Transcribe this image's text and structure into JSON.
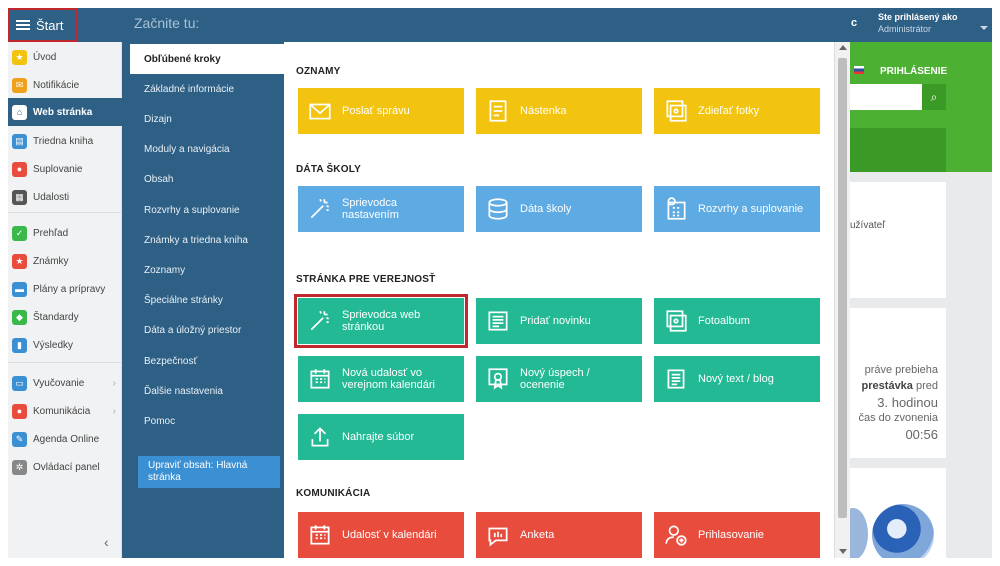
{
  "topbar": {
    "start_label": "Štart",
    "start_text": "Začnite tu:",
    "user_initial": "c",
    "user_line1": "Ste prihlásený ako",
    "user_line2": "Administrátor"
  },
  "sidebar": {
    "items": [
      {
        "label": "Úvod",
        "icon": "star-icon",
        "color": "#f2c30f"
      },
      {
        "label": "Notifikácie",
        "icon": "envelope-icon",
        "color": "#f0a11c"
      },
      {
        "label": "Web stránka",
        "icon": "home-icon",
        "color": "#2e5f84",
        "active": true
      },
      {
        "label": "Triedna kniha",
        "icon": "book-icon",
        "color": "#3b8fd3"
      },
      {
        "label": "Suplovanie",
        "icon": "person-icon",
        "color": "#e84c3d"
      },
      {
        "label": "Udalosti",
        "icon": "calendar-icon",
        "color": "#555555"
      },
      {
        "label": "Prehľad",
        "icon": "check-icon",
        "color": "#3bb84a"
      },
      {
        "label": "Známky",
        "icon": "grade-icon",
        "color": "#e84c3d"
      },
      {
        "label": "Plány a prípravy",
        "icon": "briefcase-icon",
        "color": "#3b8fd3"
      },
      {
        "label": "Štandardy",
        "icon": "shield-icon",
        "color": "#3bb84a"
      },
      {
        "label": "Výsledky",
        "icon": "bar-chart-icon",
        "color": "#3b8fd3"
      },
      {
        "label": "Vyučovanie",
        "icon": "open-book-icon",
        "color": "#3b8fd3",
        "chevron": "›"
      },
      {
        "label": "Komunikácia",
        "icon": "chat-icon",
        "color": "#e84c3d",
        "chevron": "›"
      },
      {
        "label": "Agenda Online",
        "icon": "pen-icon",
        "color": "#3b8fd3"
      },
      {
        "label": "Ovládací panel",
        "icon": "gear-icon",
        "color": "#888888"
      }
    ],
    "collapse_glyph": "‹"
  },
  "categories": {
    "items": [
      {
        "label": "Obľúbené kroky",
        "active": true
      },
      {
        "label": "Základné informácie"
      },
      {
        "label": "Dizajn"
      },
      {
        "label": "Moduly a navigácia"
      },
      {
        "label": "Obsah"
      },
      {
        "label": "Rozvrhy a suplovanie"
      },
      {
        "label": "Známky a triedna kniha"
      },
      {
        "label": "Zoznamy"
      },
      {
        "label": "Špeciálne stránky"
      },
      {
        "label": "Dáta a úložný priestor"
      },
      {
        "label": "Bezpečnosť"
      },
      {
        "label": "Ďalšie nastavenia"
      },
      {
        "label": "Pomoc"
      }
    ],
    "edit_button": "Upraviť obsah: Hlavná stránka"
  },
  "sections": [
    {
      "title": "OZNAMY",
      "tiles": [
        {
          "label": "Poslať správu",
          "icon": "envelope-icon",
          "color": "#f2c30f"
        },
        {
          "label": "Nástenka",
          "icon": "note-icon",
          "color": "#f2c30f"
        },
        {
          "label": "Zdieľať fotky",
          "icon": "photos-icon",
          "color": "#f2c30f"
        }
      ]
    },
    {
      "title": "DÁTA ŠKOLY",
      "tiles": [
        {
          "label": "Sprievodca nastavením",
          "icon": "magic-wand-icon",
          "color": "#5eaae3"
        },
        {
          "label": "Dáta školy",
          "icon": "database-icon",
          "color": "#5eaae3"
        },
        {
          "label": "Rozvrhy a suplovanie",
          "icon": "schedule-icon",
          "color": "#5eaae3"
        }
      ]
    },
    {
      "title": "STRÁNKA PRE VEREJNOSŤ",
      "tiles": [
        {
          "label": "Sprievodca web stránkou",
          "icon": "magic-wand-icon",
          "color": "#23b994",
          "highlight": true
        },
        {
          "label": "Pridať novinku",
          "icon": "newspaper-icon",
          "color": "#23b994"
        },
        {
          "label": "Fotoalbum",
          "icon": "photos-icon",
          "color": "#23b994"
        },
        {
          "label": "Nová udalosť vo verejnom kalendári",
          "icon": "calendar-icon",
          "color": "#23b994"
        },
        {
          "label": "Nový úspech / ocenenie",
          "icon": "certificate-icon",
          "color": "#23b994"
        },
        {
          "label": "Nový text / blog",
          "icon": "text-icon",
          "color": "#23b994"
        },
        {
          "label": "Nahrajte súbor",
          "icon": "upload-icon",
          "color": "#23b994"
        }
      ]
    },
    {
      "title": "KOMUNIKÁCIA",
      "tiles": [
        {
          "label": "Udalosť v kalendári",
          "icon": "calendar-icon",
          "color": "#e84c3d"
        },
        {
          "label": "Anketa",
          "icon": "poll-icon",
          "color": "#e84c3d"
        },
        {
          "label": "Prihlasovanie",
          "icon": "add-user-icon",
          "color": "#e84c3d"
        }
      ]
    }
  ],
  "background_page": {
    "login_label": "PRIHLÁSENIE",
    "user_snippet": "užívateľ",
    "status_line1": "práve prebieha",
    "status_line2_bold": "prestávka",
    "status_line2_rest": " pred",
    "status_line3": "3. hodinou",
    "status_line4": "čas do zvonenia",
    "status_time": "00:56"
  }
}
